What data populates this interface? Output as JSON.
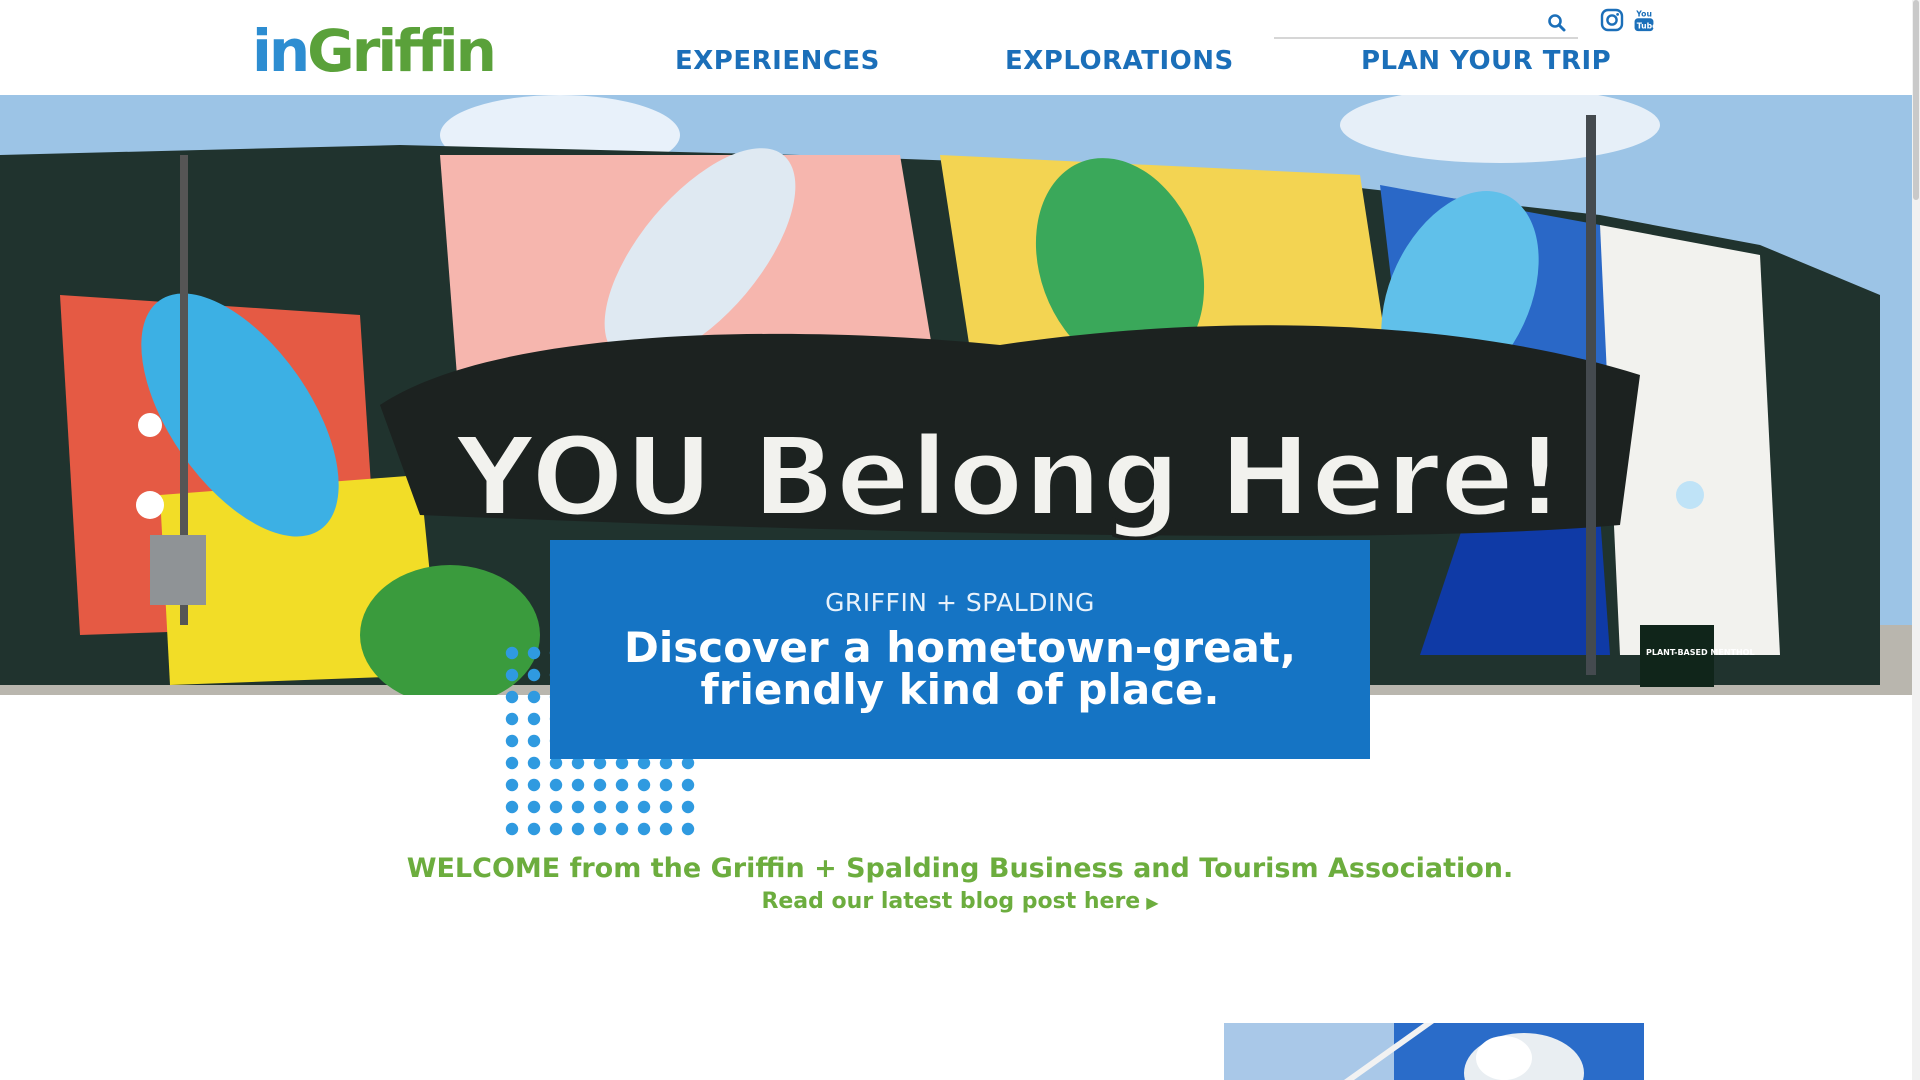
{
  "header": {
    "logo_part1": "in",
    "logo_part2": "Griffin",
    "search": {
      "placeholder": "",
      "value": ""
    },
    "social": [
      "instagram-icon",
      "youtube-icon"
    ],
    "nav": [
      "EXPERIENCES",
      "EXPLORATIONS",
      "PLAN YOUR TRIP"
    ]
  },
  "hero": {
    "mural_text": "YOU Belong Here!",
    "sign_text": "PLANT-BASED MENTHOL"
  },
  "callout": {
    "subtitle": "GRIFFIN + SPALDING",
    "headline_line1": "Discover a hometown-great,",
    "headline_line2": "friendly kind of place."
  },
  "welcome": {
    "text": "WELCOME from the Griffin + Spalding Business and Tourism Association.",
    "link": "Read our latest blog post here"
  },
  "colors": {
    "brand_blue": "#1b6fb9",
    "callout_blue": "#1574c4",
    "brand_green": "#6cad3e",
    "dot_blue": "#2f9ae0"
  }
}
